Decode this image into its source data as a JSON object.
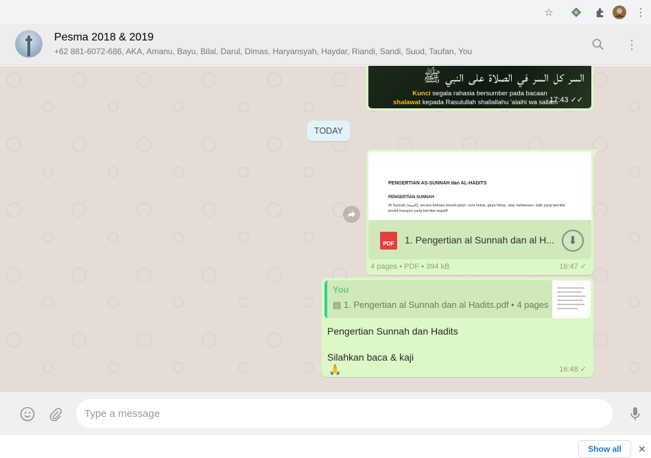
{
  "browser": {
    "icons": [
      "star-icon",
      "extension-icon",
      "puzzle-icon",
      "profile-avatar",
      "more-vert-icon"
    ],
    "star_glyph": "☆",
    "menu_glyph": "⋮"
  },
  "chat": {
    "title": "Pesma 2018 & 2019",
    "members": "+62 881-6072-686, AKA, Amanu, Bayu, Bilal, Darul, Dimas, Haryansyah, Haydar, Riandi, Sandi, Suud, Taufan, You",
    "search_glyph": "⚲",
    "menu_glyph": "⋮"
  },
  "messages": {
    "image_msg": {
      "arabic_text": "السر كل السر في الصلاة على النبي ﷺ",
      "caption_kw1": "Kunci",
      "caption_line1": " segala rahasia bersumber pada bacaan",
      "caption_kw2": "shalawat",
      "caption_line2": " kepada Rasulullah shallallahu 'alaihi wa sallam",
      "time": "17:43 ✓✓"
    },
    "date_chip": "TODAY",
    "pdf_msg": {
      "thumb_title": "PENGERTIAN AS-SUNNAH dan AL-HADITS",
      "thumb_subtitle": "PENGERTIAN SUNNAH",
      "thumb_body": "Al Sunnah (السنة), secara bahasa berarti jalan, cara hidup, gaya hidup, atau kebiasaan, baik yang bernilai positif maupun yang bernilai negatif.",
      "icon_label": "PDF",
      "filename": "1. Pengertian al Sunnah dan al H...",
      "meta": "4 pages • PDF • 394 kB",
      "time": "16:47",
      "tick": "✓",
      "download_glyph": "⬇"
    },
    "reply_msg": {
      "quote_author": "You",
      "quote_text": "▤ 1. Pengertian al Sunnah dan al Hadits.pdf • 4 pages",
      "line1": "Pengertian Sunnah dan Hadits",
      "line2": "Silahkan baca & kaji",
      "emoji": "🙏",
      "time": "16:48",
      "tick": "✓"
    }
  },
  "composer": {
    "placeholder": "Type a message",
    "emoji_glyph": "☺",
    "attach_glyph": "📎",
    "mic_glyph": "🎙"
  },
  "download_bar": {
    "show_all": "Show all",
    "close": "✕"
  },
  "colors": {
    "outgoing_bubble": "#dcf8c6",
    "chat_bg": "#e5ddd5",
    "quote_accent": "#35cd96"
  }
}
